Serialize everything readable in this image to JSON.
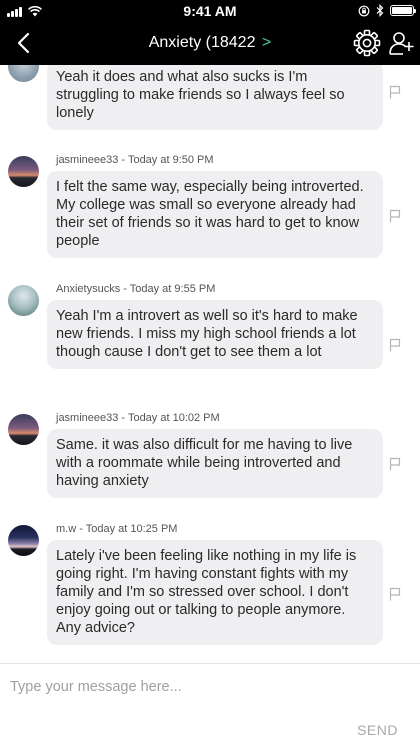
{
  "status_bar": {
    "time": "9:41 AM",
    "battery_level": 1.0
  },
  "nav": {
    "title": "Anxiety (18422",
    "chevron": ">"
  },
  "messages": [
    {
      "sender": "",
      "text": "Yeah it does and what also sucks is I'm struggling to make friends so I always feel so lonely"
    },
    {
      "sender": "jasmineee33 - Today at 9:50 PM",
      "text": "I felt the same way, especially being introverted. My college was small so everyone already had their set of friends so it was hard to get to know people"
    },
    {
      "sender": "Anxietysucks - Today at 9:55 PM",
      "text": "Yeah I'm a introvert as well so it's hard to make new friends. I miss my high school friends a lot though cause I don't get to see them a lot"
    },
    {
      "sender": "jasmineee33 - Today at 10:02 PM",
      "text": "Same. it was also difficult for me having to live with a roommate while being introverted and having anxiety"
    },
    {
      "sender": "m.w - Today at 10:25 PM",
      "text": "Lately i've been feeling like nothing in my life is going right. I'm having constant fights with my family and I'm so stressed over school. I don't enjoy going out or talking to people anymore. Any advice?"
    }
  ],
  "composer": {
    "placeholder": "Type your message here...",
    "send_label": "SEND"
  },
  "icons": {
    "back": "chevron-left-icon",
    "settings": "gear-icon",
    "add_user": "add-user-icon",
    "report": "flag-icon"
  },
  "colors": {
    "accent": "#4cc9a8",
    "bubble": "#efeff1",
    "bar": "#000000"
  }
}
